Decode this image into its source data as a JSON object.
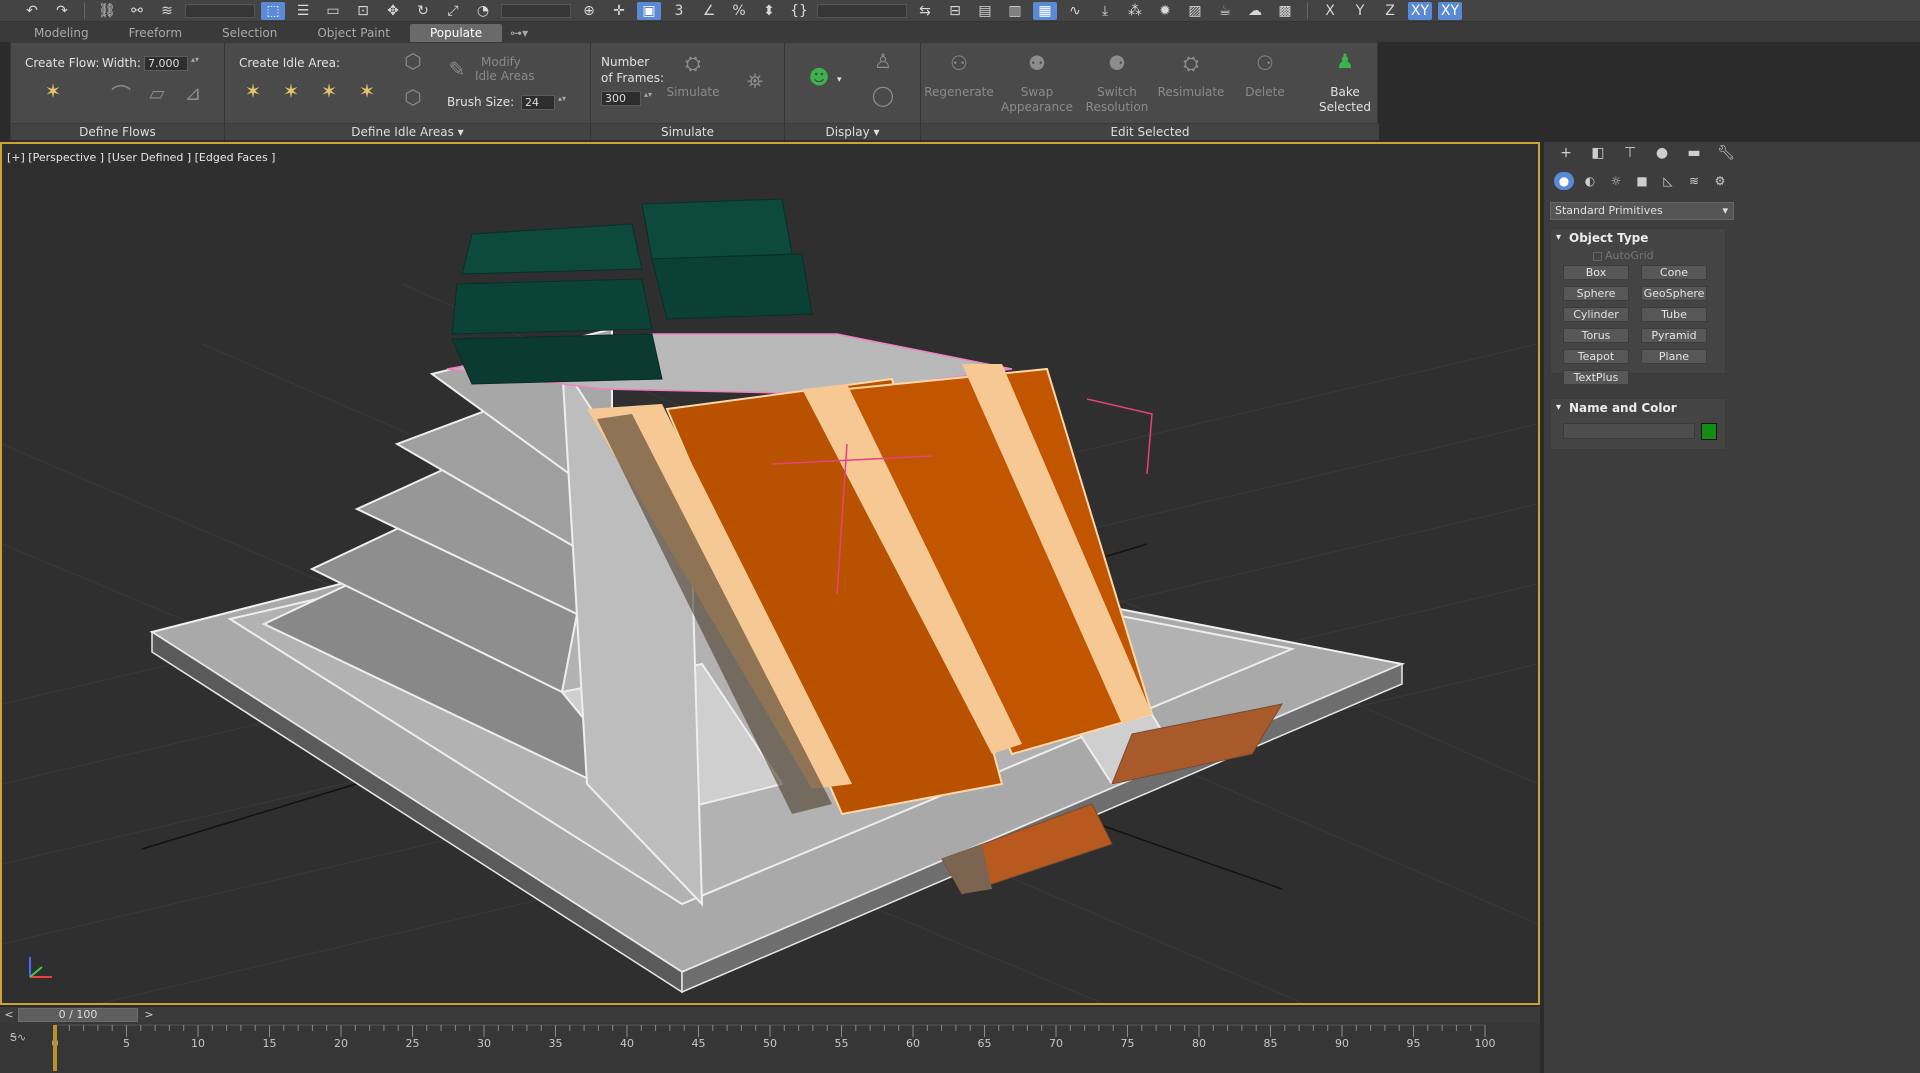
{
  "ribbon": {
    "tabs": [
      {
        "label": "Modeling"
      },
      {
        "label": "Freeform"
      },
      {
        "label": "Selection"
      },
      {
        "label": "Object Paint"
      },
      {
        "label": "Populate"
      }
    ],
    "define_flows": {
      "create_flow_label": "Create Flow:",
      "width_label": "Width:",
      "width_value": "7.000",
      "title": "Define Flows"
    },
    "define_idle": {
      "create_idle_label": "Create Idle Area:",
      "modify_idle_line1": "Modify",
      "modify_idle_line2": "Idle Areas",
      "brush_size_label": "Brush Size:",
      "brush_size_value": "24",
      "title": "Define Idle Areas"
    },
    "simulate": {
      "frames_line1": "Number",
      "frames_line2": "of Frames:",
      "frames_value": "300",
      "simulate_label": "Simulate",
      "title": "Simulate"
    },
    "display": {
      "title": "Display"
    },
    "edit_selected": {
      "regenerate": "Regenerate",
      "swap_line1": "Swap",
      "swap_line2": "Appearance",
      "switch_line1": "Switch",
      "switch_line2": "Resolution",
      "resimulate": "Resimulate",
      "delete": "Delete",
      "bake_line1": "Bake",
      "bake_line2": "Selected",
      "title": "Edit Selected"
    }
  },
  "viewport": {
    "label": "[+] [Perspective ] [User Defined ] [Edged Faces ]"
  },
  "command_panel": {
    "primitive_category": "Standard Primitives",
    "object_type": {
      "title": "Object Type",
      "autogrid": "AutoGrid",
      "buttons": [
        "Box",
        "Cone",
        "Sphere",
        "GeoSphere",
        "Cylinder",
        "Tube",
        "Torus",
        "Pyramid",
        "Teapot",
        "Plane",
        "TextPlus"
      ]
    },
    "name_and_color": {
      "title": "Name and Color",
      "color": "#128c12"
    }
  },
  "timeline": {
    "slider_text": "0 / 100",
    "ticks": [
      0,
      5,
      10,
      15,
      20,
      25,
      30,
      35,
      40,
      45,
      50,
      55,
      60,
      65,
      70,
      75,
      80,
      85,
      90,
      95,
      100
    ],
    "current_frame": 0
  }
}
